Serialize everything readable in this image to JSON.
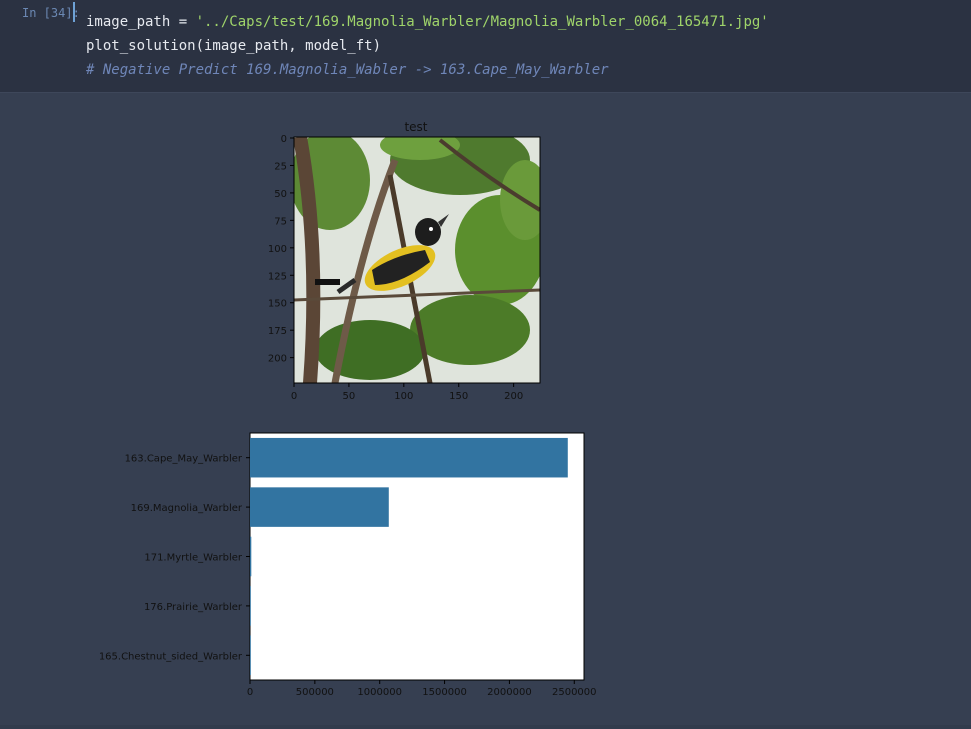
{
  "cell": {
    "prompt": "In [34]:",
    "line1_prefix": "image_path = ",
    "line1_string": "'../Caps/test/169.Magnolia_Warbler/Magnolia_Warbler_0064_165471.jpg'",
    "line2": "plot_solution(image_path, model_ft)",
    "line3_comment": "# Negative Predict 169.Magnolia_Wabler -> 163.Cape_May_Warbler"
  },
  "image_plot": {
    "title": "test",
    "x_ticks": [
      "0",
      "50",
      "100",
      "150",
      "200"
    ],
    "y_ticks": [
      "0",
      "25",
      "50",
      "75",
      "100",
      "125",
      "150",
      "175",
      "200"
    ],
    "image_name": "magnolia-warbler-photo"
  },
  "colors": {
    "bar": "#3274a1",
    "background": "#323b4c",
    "cell_input": "#2b3242"
  },
  "chart_data": {
    "type": "bar",
    "orientation": "horizontal",
    "categories": [
      "163.Cape_May_Warbler",
      "169.Magnolia_Warbler",
      "171.Myrtle_Warbler",
      "176.Prairie_Warbler",
      "165.Chestnut_sided_Warbler"
    ],
    "values": [
      2450000,
      1070000,
      10000,
      2000,
      1000
    ],
    "x_ticks": [
      "0",
      "500000",
      "1000000",
      "1500000",
      "2000000",
      "2500000"
    ],
    "xlim": [
      0,
      2575000
    ],
    "grid": false
  }
}
